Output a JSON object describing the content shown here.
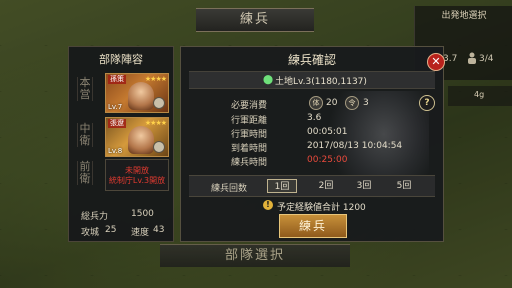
{
  "map": {
    "top_banner": "練兵",
    "bottom_banner": "部隊選択",
    "side_panel": {
      "title": "出発地選択",
      "ratio_a": "3.7",
      "ratio_b": "3/4",
      "level": "4g"
    }
  },
  "unit_panel": {
    "title": "部隊陣容",
    "slot_labels": [
      "本\n営",
      "中\n衛",
      "前\n衛"
    ],
    "cards": [
      {
        "name": "孫策",
        "stars": "★★★★",
        "level": "Lv.7"
      },
      {
        "name": "張遼",
        "stars": "★★★★",
        "level": "Lv.8"
      }
    ],
    "locked_line1": "未開放",
    "locked_line2": "統制庁Lv.3開放",
    "stats": {
      "troops_label": "総兵力",
      "troops_value": "1500",
      "siege_label": "攻城",
      "siege_value": "25",
      "speed_label": "速度",
      "speed_value": "43"
    }
  },
  "dialog": {
    "title": "練兵確認",
    "close_glyph": "✕",
    "location": "土地Lv.3(1180,1137)",
    "rows": [
      {
        "label": "必要消費",
        "value": ""
      },
      {
        "label": "行軍距離",
        "value": "3.6"
      },
      {
        "label": "行軍時間",
        "value": "00:05:01"
      },
      {
        "label": "到着時間",
        "value": "2017/08/13 10:04:54"
      },
      {
        "label": "練兵時間",
        "value": "00:25:00"
      }
    ],
    "costs": [
      {
        "icon": "体",
        "value": "20"
      },
      {
        "icon": "令",
        "value": "3"
      }
    ],
    "help_glyph": "?",
    "count_label": "練兵回数",
    "count_options": [
      "1回",
      "2回",
      "3回",
      "5回"
    ],
    "selected_count": "1回",
    "exp_text": "予定経験値合計 1200",
    "warn_glyph": "!",
    "train_button": "練兵"
  },
  "colors": {
    "accent_red": "#e84a3c",
    "button_gold": "#c8913a",
    "close_red": "#b8221c"
  }
}
